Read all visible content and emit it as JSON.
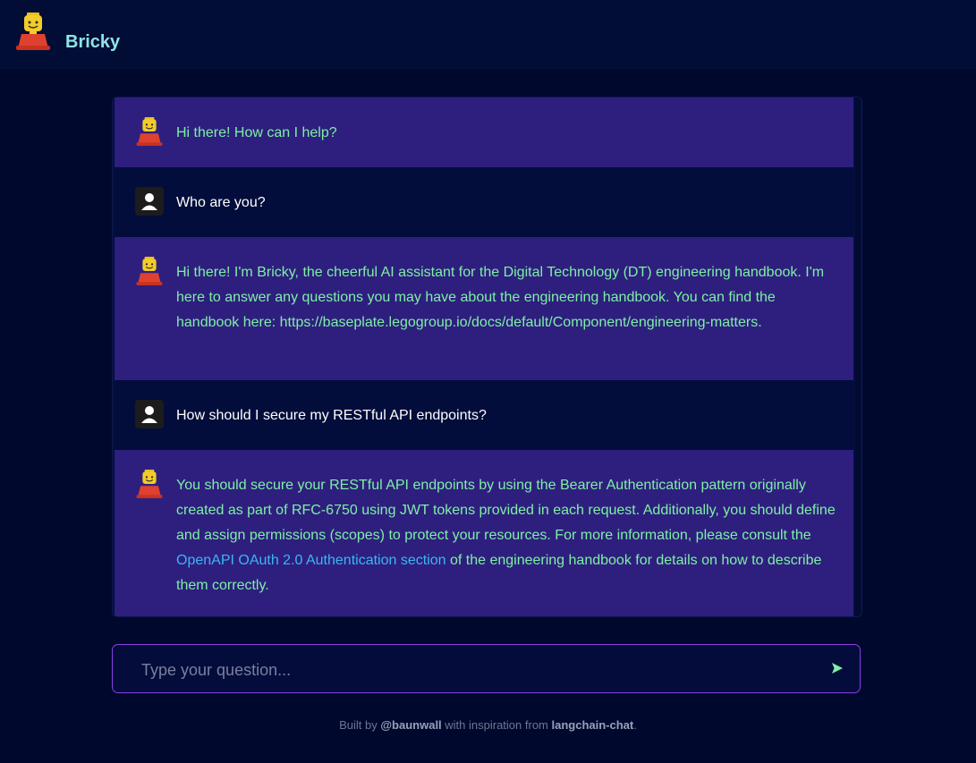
{
  "header": {
    "app_name": "Bricky",
    "avatar_icon": "lego-minifigure-icon"
  },
  "messages": [
    {
      "role": "bot",
      "text": "Hi there! How can I help?"
    },
    {
      "role": "user",
      "text": "Who are you?"
    },
    {
      "role": "bot",
      "text": "Hi there! I'm Bricky, the cheerful AI assistant for the Digital Technology (DT) engineering handbook. I'm here to answer any questions you may have about the engineering handbook. You can find the handbook here: https://baseplate.legogroup.io/docs/default/Component/engineering-matters."
    },
    {
      "role": "user",
      "text": "How should I secure my RESTful API endpoints?"
    },
    {
      "role": "bot",
      "text_before": "You should secure your RESTful API endpoints by using the Bearer Authentication pattern originally created as part of RFC-6750 using JWT tokens provided in each request. Additionally, you should define and assign permissions (scopes) to protect your resources. For more information, please consult the ",
      "link_text": "OpenAPI OAuth 2.0 Authentication section",
      "text_after": " of the engineering handbook for details on how to describe them correctly."
    }
  ],
  "input": {
    "placeholder": "Type your question...",
    "value": "",
    "send_icon": "send-arrow-icon"
  },
  "footer": {
    "prefix": "Built by ",
    "author": "@baunwall",
    "middle": " with inspiration from ",
    "project": "langchain-chat",
    "suffix": "."
  },
  "colors": {
    "background": "#01082e",
    "bot_bubble": "#2e1f7e",
    "user_bubble": "#030d3b",
    "bot_text": "#7ef0a5",
    "link": "#3bb6f5",
    "brand": "#8fe3e6",
    "input_border": "#8a3fe0"
  }
}
